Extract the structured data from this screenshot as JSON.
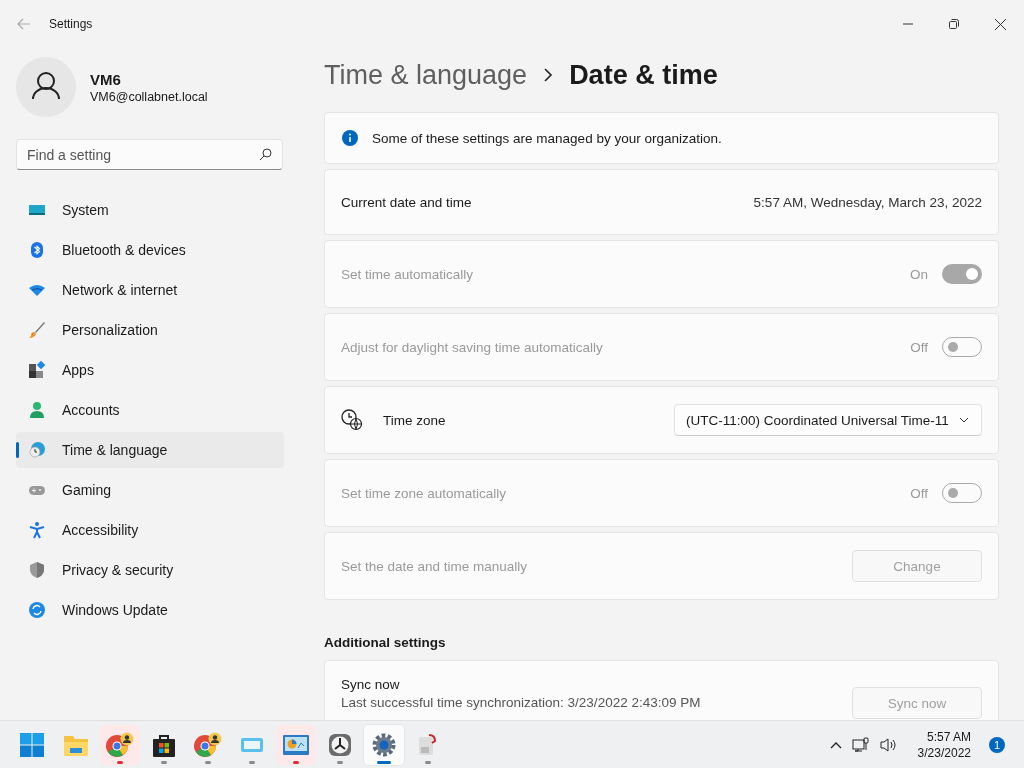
{
  "window": {
    "title": "Settings"
  },
  "user": {
    "name": "VM6",
    "email": "VM6@collabnet.local"
  },
  "search": {
    "placeholder": "Find a setting"
  },
  "sidebar": {
    "items": [
      {
        "label": "System",
        "selected": false
      },
      {
        "label": "Bluetooth & devices",
        "selected": false
      },
      {
        "label": "Network & internet",
        "selected": false
      },
      {
        "label": "Personalization",
        "selected": false
      },
      {
        "label": "Apps",
        "selected": false
      },
      {
        "label": "Accounts",
        "selected": false
      },
      {
        "label": "Time & language",
        "selected": true
      },
      {
        "label": "Gaming",
        "selected": false
      },
      {
        "label": "Accessibility",
        "selected": false
      },
      {
        "label": "Privacy & security",
        "selected": false
      },
      {
        "label": "Windows Update",
        "selected": false
      }
    ]
  },
  "breadcrumb": {
    "parent": "Time & language",
    "current": "Date & time"
  },
  "rows": [
    {
      "kind": "info",
      "label": "Some of these settings are managed by your organization."
    },
    {
      "kind": "value",
      "label": "Current date and time",
      "value": "5:57 AM, Wednesday, March 23, 2022"
    },
    {
      "kind": "toggle",
      "label": "Set time automatically",
      "disabled": true,
      "on": true,
      "state": "On"
    },
    {
      "kind": "toggle",
      "label": "Adjust for daylight saving time automatically",
      "disabled": true,
      "on": false,
      "state": "Off"
    },
    {
      "kind": "dropdown",
      "label": "Time zone",
      "disabled": false,
      "value": "(UTC-11:00) Coordinated Universal Time-11"
    },
    {
      "kind": "toggle",
      "label": "Set time zone automatically",
      "disabled": true,
      "on": false,
      "state": "Off"
    },
    {
      "kind": "button",
      "label": "Set the date and time manually",
      "disabled": true,
      "button": "Change"
    }
  ],
  "additional": {
    "heading": "Additional settings",
    "title": "Sync now",
    "lines": [
      "Last successful time synchronization: 3/23/2022 2:43:09 PM"
    ],
    "button": "Sync now",
    "disabled": true
  },
  "taskbar": {
    "apps": [
      {
        "running": false,
        "selected": false,
        "flashing": false
      },
      {
        "running": false,
        "selected": false,
        "flashing": false
      },
      {
        "running": true,
        "selected": false,
        "flashing": true
      },
      {
        "running": true,
        "selected": false,
        "flashing": false
      },
      {
        "running": true,
        "selected": false,
        "flashing": false
      },
      {
        "running": true,
        "selected": false,
        "flashing": false
      },
      {
        "running": true,
        "selected": false,
        "flashing": true
      },
      {
        "running": true,
        "selected": false,
        "flashing": false
      },
      {
        "running": true,
        "selected": true,
        "flashing": false
      },
      {
        "running": true,
        "selected": false,
        "flashing": false
      }
    ],
    "time": "5:57 AM",
    "date": "3/23/2022",
    "notifications": "1"
  }
}
